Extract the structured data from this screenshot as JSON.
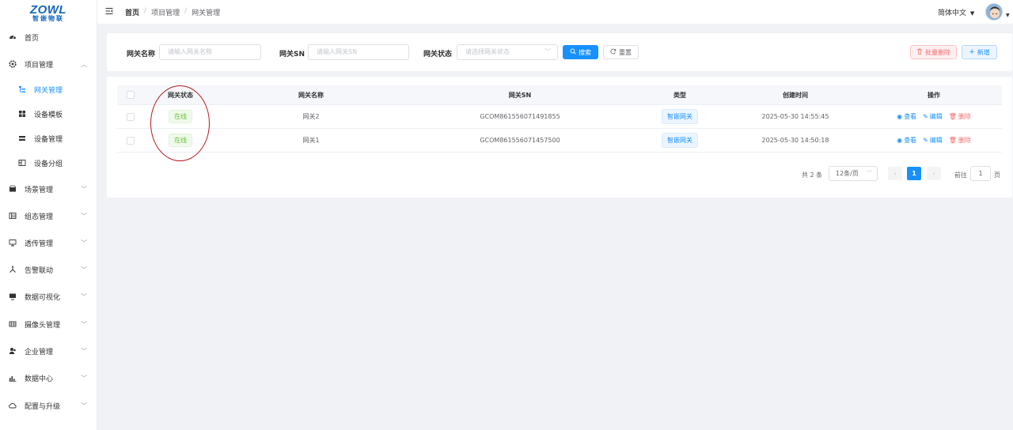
{
  "logo": {
    "main": "ZOWL",
    "sub": "智嵌物联"
  },
  "sidebar": {
    "items": [
      {
        "label": "首页",
        "icon": "dashboard-icon"
      },
      {
        "label": "项目管理",
        "icon": "gear-icon",
        "expanded": true,
        "children": [
          {
            "label": "网关管理",
            "icon": "tree-icon",
            "active": true
          },
          {
            "label": "设备模板",
            "icon": "grid-icon"
          },
          {
            "label": "设备管理",
            "icon": "list-icon"
          },
          {
            "label": "设备分组",
            "icon": "group-icon"
          }
        ]
      },
      {
        "label": "场景管理",
        "icon": "scene-icon"
      },
      {
        "label": "组态管理",
        "icon": "layout-icon"
      },
      {
        "label": "透传管理",
        "icon": "monitor-icon"
      },
      {
        "label": "告警联动",
        "icon": "share-icon"
      },
      {
        "label": "数据可视化",
        "icon": "screen-icon"
      },
      {
        "label": "摄像头管理",
        "icon": "camera-icon"
      },
      {
        "label": "企业管理",
        "icon": "users-icon"
      },
      {
        "label": "数据中心",
        "icon": "chart-icon"
      },
      {
        "label": "配置与升级",
        "icon": "cloud-icon"
      }
    ]
  },
  "header": {
    "breadcrumb": [
      "首页",
      "项目管理",
      "网关管理"
    ],
    "language": "简体中文"
  },
  "search": {
    "name_label": "网关名称",
    "name_placeholder": "请输入网关名称",
    "sn_label": "网关SN",
    "sn_placeholder": "请输入网关SN",
    "status_label": "网关状态",
    "status_placeholder": "请选择网关状态",
    "search_btn": "搜索",
    "reset_btn": "重置",
    "batch_delete_btn": "批量删除",
    "add_btn": "新增"
  },
  "table": {
    "headers": [
      "网关状态",
      "网关名称",
      "网关SN",
      "类型",
      "创建时间",
      "操作"
    ],
    "rows": [
      {
        "status": "在线",
        "name": "网关2",
        "sn": "GCOM861556071491855",
        "type": "智嵌网关",
        "time": "2025-05-30 14:55:45"
      },
      {
        "status": "在线",
        "name": "网关1",
        "sn": "GCOM861556071457500",
        "type": "智嵌网关",
        "time": "2025-05-30 14:50:18"
      }
    ],
    "ops": {
      "view": "查看",
      "edit": "编辑",
      "delete": "删除"
    }
  },
  "pagination": {
    "total_text": "共 2 条",
    "page_size": "12条/页",
    "current": "1",
    "goto_label": "前往",
    "goto_value": "1",
    "page_suffix": "页"
  },
  "colors": {
    "primary": "#1890ff",
    "success": "#67c23a",
    "danger": "#f56c6c",
    "annotation": "#b71c1c"
  }
}
